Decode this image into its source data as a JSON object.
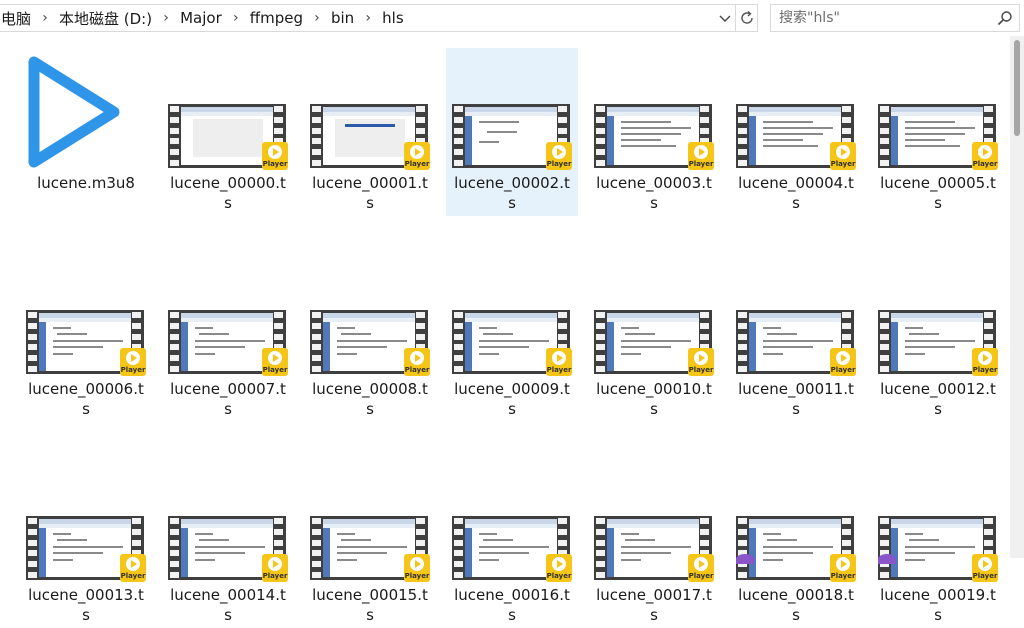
{
  "breadcrumb": [
    "电脑",
    "本地磁盘 (D:)",
    "Major",
    "ffmpeg",
    "bin",
    "hls"
  ],
  "search": {
    "placeholder": "搜索\"hls\""
  },
  "player_badge_text": "Player",
  "accent_color": "#2f95e8",
  "selected_index": 3,
  "files": [
    "lucene.m3u8",
    "lucene_00000.ts",
    "lucene_00001.ts",
    "lucene_00002.ts",
    "lucene_00003.ts",
    "lucene_00004.ts",
    "lucene_00005.ts",
    "lucene_00006.ts",
    "lucene_00007.ts",
    "lucene_00008.ts",
    "lucene_00009.ts",
    "lucene_00010.ts",
    "lucene_00011.ts",
    "lucene_00012.ts",
    "lucene_00013.ts",
    "lucene_00014.ts",
    "lucene_00015.ts",
    "lucene_00016.ts",
    "lucene_00017.ts",
    "lucene_00018.ts",
    "lucene_00019.ts"
  ]
}
